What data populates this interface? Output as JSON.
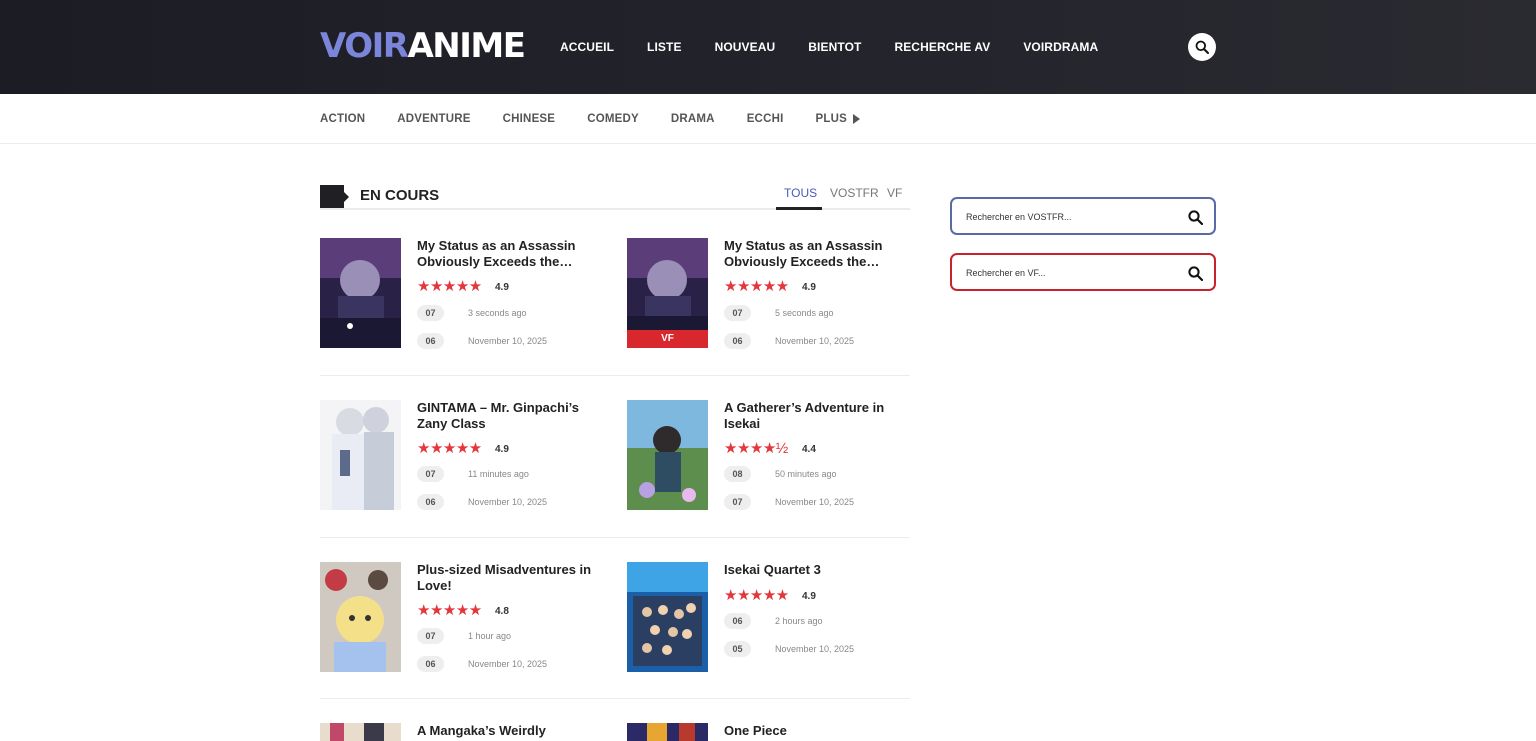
{
  "brand": {
    "part1": "VOIR",
    "part2": "ANIME"
  },
  "nav": [
    "ACCUEIL",
    "LISTE",
    "NOUVEAU",
    "BIENTOT",
    "RECHERCHE AV",
    "VOIRDRAMA"
  ],
  "genres": [
    "ACTION",
    "ADVENTURE",
    "CHINESE",
    "COMEDY",
    "DRAMA",
    "ECCHI"
  ],
  "genres_more": "PLUS",
  "section": {
    "title": "EN COURS",
    "tabs": [
      "TOUS",
      "VOSTFR",
      "VF"
    ],
    "active_tab": "TOUS"
  },
  "cards": [
    {
      "title": "My Status as an Assassin Obviously Exceeds the…",
      "stars": "★★★★★",
      "rating": "4.9",
      "ep1": "07",
      "time1": "3 seconds ago",
      "ep2": "06",
      "time2": "November 10, 2025",
      "badge": ""
    },
    {
      "title": "My Status as an Assassin Obviously Exceeds the…",
      "stars": "★★★★★",
      "rating": "4.9",
      "ep1": "07",
      "time1": "5 seconds ago",
      "ep2": "06",
      "time2": "November 10, 2025",
      "badge": "VF"
    },
    {
      "title": "GINTAMA – Mr. Ginpachi’s Zany Class",
      "stars": "★★★★★",
      "rating": "4.9",
      "ep1": "07",
      "time1": "11 minutes ago",
      "ep2": "06",
      "time2": "November 10, 2025",
      "badge": ""
    },
    {
      "title": "A Gatherer’s Adventure in Isekai",
      "stars": "★★★★½",
      "rating": "4.4",
      "ep1": "08",
      "time1": "50 minutes ago",
      "ep2": "07",
      "time2": "November 10, 2025",
      "badge": ""
    },
    {
      "title": "Plus-sized Misadventures in Love!",
      "stars": "★★★★★",
      "rating": "4.8",
      "ep1": "07",
      "time1": "1 hour ago",
      "ep2": "06",
      "time2": "November 10, 2025",
      "badge": ""
    },
    {
      "title": "Isekai Quartet 3",
      "stars": "★★★★★",
      "rating": "4.9",
      "ep1": "06",
      "time1": "2 hours ago",
      "ep2": "05",
      "time2": "November 10, 2025",
      "badge": ""
    },
    {
      "title": "A Mangaka’s Weirdly",
      "stars": "",
      "rating": "",
      "ep1": "",
      "time1": "",
      "ep2": "",
      "time2": "",
      "badge": ""
    },
    {
      "title": "One Piece",
      "stars": "",
      "rating": "",
      "ep1": "",
      "time1": "",
      "ep2": "",
      "time2": "",
      "badge": ""
    }
  ],
  "sidebar": {
    "vostfr_placeholder": "Rechercher en VOSTFR...",
    "vf_placeholder": "Rechercher en VF..."
  },
  "colors": {
    "header_bg": "#1c1c24",
    "logo_accent": "#7b86db",
    "star": "#e2373c",
    "vf_badge": "#d8282d",
    "vostfr_border": "#5a6aa8",
    "vf_border": "#c8232b"
  },
  "icons": {
    "header_search": "search-icon",
    "vostfr_search": "search-icon",
    "vf_search": "search-icon",
    "plus_arrow": "triangle-right-icon"
  }
}
